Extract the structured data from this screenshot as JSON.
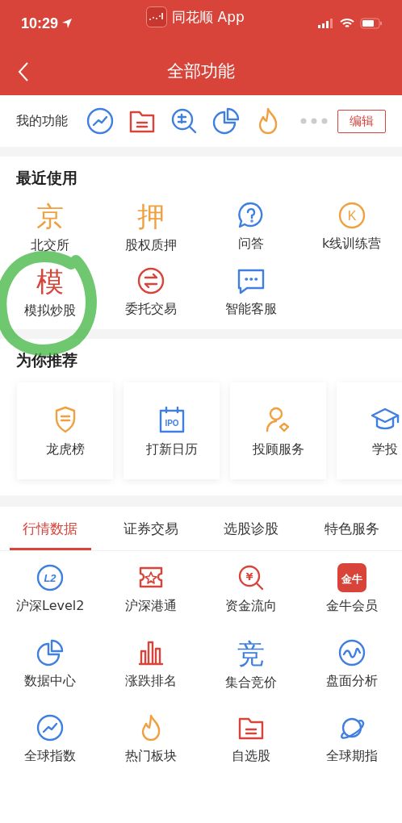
{
  "status_bar": {
    "time": "10:29",
    "app": "同花顺 App"
  },
  "nav": {
    "title": "全部功能"
  },
  "my_functions": {
    "label": "我的功能",
    "icons": [
      {
        "kind": "trend",
        "color": "#3f7fe0"
      },
      {
        "kind": "folder",
        "color": "#d9443a"
      },
      {
        "kind": "pick",
        "color": "#3f7fe0"
      },
      {
        "kind": "pie",
        "color": "#3f7fe0"
      },
      {
        "kind": "flame",
        "color": "#f0a040"
      }
    ],
    "edit_button": "编辑"
  },
  "recent": {
    "title": "最近使用",
    "items": [
      {
        "label": "北交所",
        "kind": "glyph",
        "glyph": "京",
        "color": "#f0a040",
        "circled": false
      },
      {
        "label": "股权质押",
        "kind": "glyph",
        "glyph": "押",
        "color": "#f0a040",
        "circled": false
      },
      {
        "label": "问答",
        "kind": "question",
        "color": "#3f7fe0",
        "circled": false
      },
      {
        "label": "k线训练营",
        "kind": "kcircle",
        "glyph": "K",
        "color": "#f0a040",
        "circled": false
      },
      {
        "label": "模拟炒股",
        "kind": "glyph",
        "glyph": "模",
        "color": "#d9443a",
        "circled": true
      },
      {
        "label": "委托交易",
        "kind": "exchange",
        "color": "#d9443a",
        "circled": false
      },
      {
        "label": "智能客服",
        "kind": "chat",
        "color": "#3f7fe0",
        "circled": false
      }
    ]
  },
  "recommend": {
    "title": "为你推荐",
    "cards": [
      {
        "label": "龙虎榜",
        "kind": "shield",
        "color": "#f0a040"
      },
      {
        "label": "打新日历",
        "kind": "calendar",
        "glyph": "IPO",
        "color": "#3f7fe0"
      },
      {
        "label": "投顾服务",
        "kind": "advisor",
        "color": "#f0a040"
      },
      {
        "label": "学投",
        "kind": "cap",
        "color": "#3f7fe0"
      }
    ]
  },
  "tabs": [
    {
      "label": "行情数据",
      "selected": true
    },
    {
      "label": "证券交易",
      "selected": false
    },
    {
      "label": "选股诊股",
      "selected": false
    },
    {
      "label": "特色服务",
      "selected": false
    }
  ],
  "grid": [
    {
      "label": "沪深Level2",
      "kind": "l2",
      "glyph": "L2",
      "color": "#3f7fe0"
    },
    {
      "label": "沪深港通",
      "kind": "hk",
      "color": "#d9443a"
    },
    {
      "label": "资金流向",
      "kind": "money",
      "glyph": "¥",
      "color": "#d9443a"
    },
    {
      "label": "金牛会员",
      "kind": "badge",
      "glyph": "金牛",
      "color": "#d9443a"
    },
    {
      "label": "数据中心",
      "kind": "pie",
      "color": "#3f7fe0"
    },
    {
      "label": "涨跌排名",
      "kind": "bars",
      "color": "#d9443a"
    },
    {
      "label": "集合竞价",
      "kind": "glyph",
      "glyph": "竞",
      "color": "#3f7fe0"
    },
    {
      "label": "盘面分析",
      "kind": "wave",
      "color": "#3f7fe0"
    },
    {
      "label": "全球指数",
      "kind": "trend",
      "color": "#3f7fe0"
    },
    {
      "label": "热门板块",
      "kind": "flame",
      "color": "#f0a040"
    },
    {
      "label": "自选股",
      "kind": "folder",
      "color": "#d9443a"
    },
    {
      "label": "全球期指",
      "kind": "planet",
      "color": "#3f7fe0"
    }
  ]
}
